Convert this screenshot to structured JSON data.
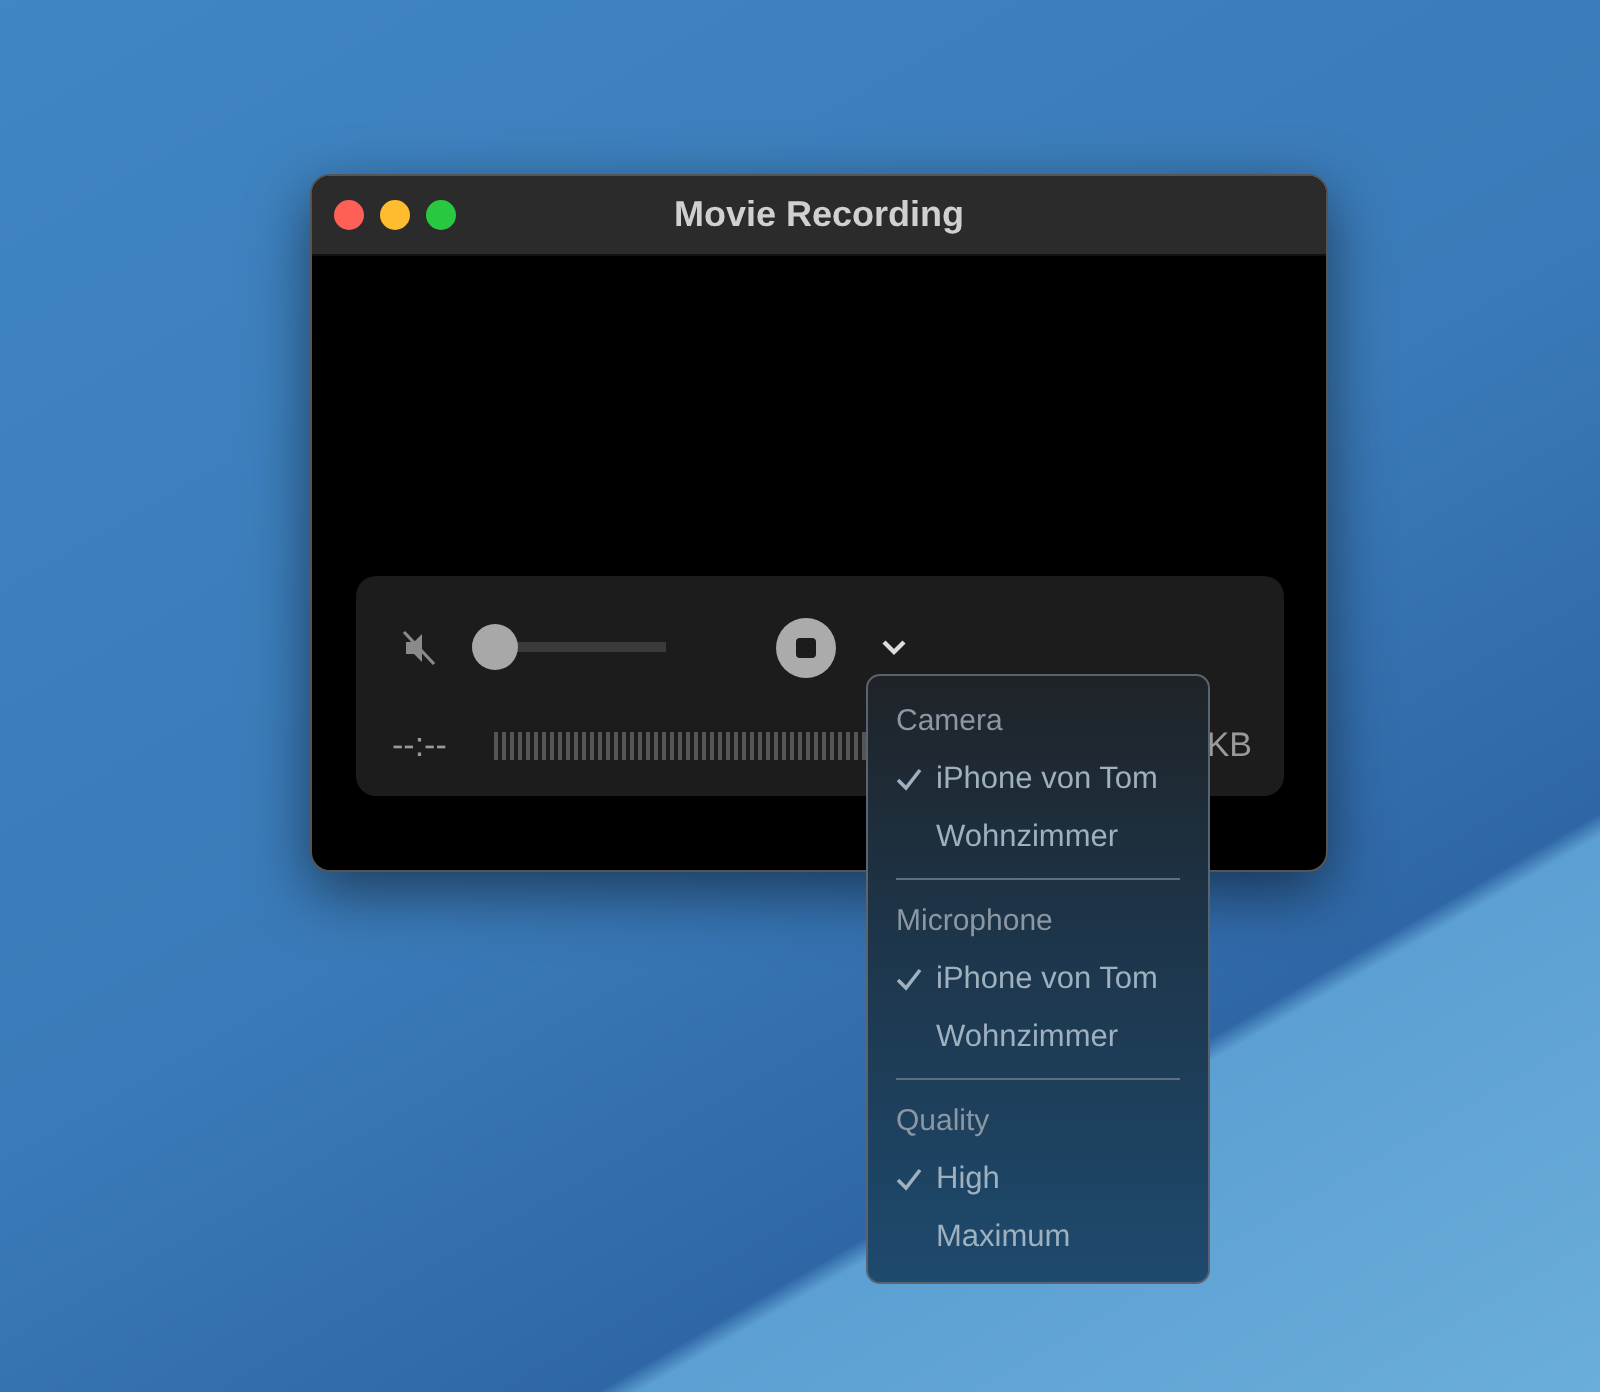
{
  "window": {
    "title": "Movie Recording"
  },
  "controls": {
    "muted": true,
    "volume": {
      "level": 0
    },
    "time": "--:--",
    "size": "KB"
  },
  "menu": {
    "sections": [
      {
        "heading": "Camera",
        "items": [
          {
            "label": "iPhone von Tom",
            "selected": true
          },
          {
            "label": "Wohnzimmer",
            "selected": false
          }
        ]
      },
      {
        "heading": "Microphone",
        "items": [
          {
            "label": "iPhone von Tom",
            "selected": true
          },
          {
            "label": "Wohnzimmer",
            "selected": false
          }
        ]
      },
      {
        "heading": "Quality",
        "items": [
          {
            "label": "High",
            "selected": true
          },
          {
            "label": "Maximum",
            "selected": false
          }
        ]
      }
    ]
  }
}
